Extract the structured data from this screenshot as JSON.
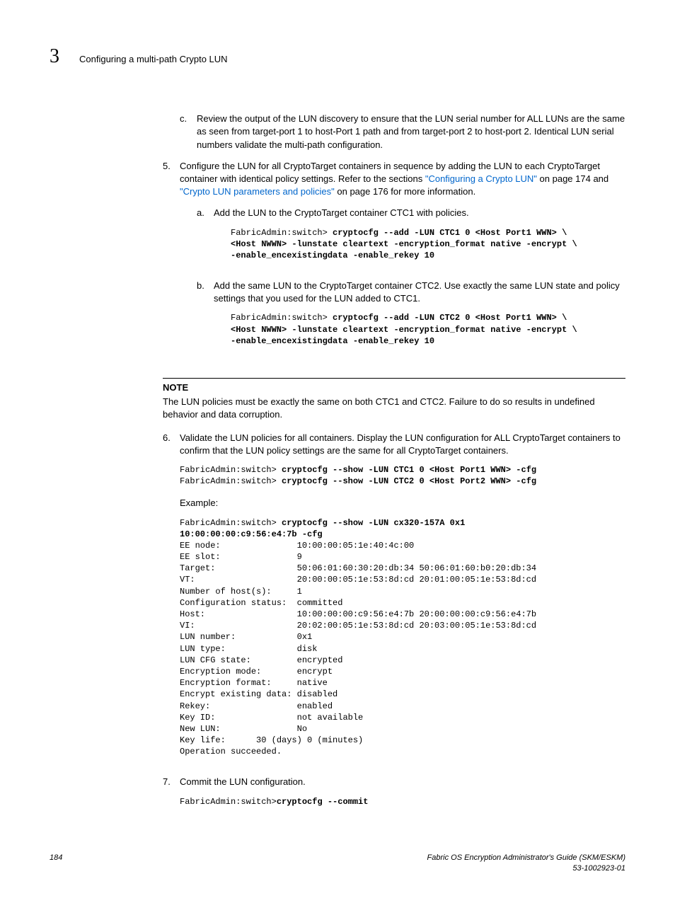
{
  "header": {
    "chapter": "3",
    "title": "Configuring a multi-path Crypto LUN"
  },
  "step_c": {
    "marker": "c.",
    "text": "Review the output of the LUN discovery to ensure that the LUN serial number for ALL LUNs are the same as seen from target-port 1 to host-Port 1 path and from target-port 2 to host-port 2. Identical LUN serial numbers validate the multi-path configuration."
  },
  "step5": {
    "marker": "5.",
    "text_before": "Configure the LUN for all CryptoTarget containers in sequence by adding the LUN to each CryptoTarget container with identical policy settings. Refer to the sections ",
    "link1": "\"Configuring a Crypto LUN\"",
    "text_mid": " on page 174 and ",
    "link2": "\"Crypto LUN parameters and policies\"",
    "text_after": " on page 176 for more information.",
    "sub_a": {
      "marker": "a.",
      "text": "Add the LUN to the CryptoTarget container CTC1 with policies.",
      "prompt": "FabricAdmin:switch> ",
      "cmd": "cryptocfg --add -LUN CTC1 0 <Host Port1 WWN> \\\n<Host NWWN> -lunstate cleartext -encryption_format native -encrypt \\\n-enable_encexistingdata -enable_rekey 10"
    },
    "sub_b": {
      "marker": "b.",
      "text": "Add the same LUN to the CryptoTarget container CTC2. Use exactly the same LUN state and policy settings that you used for the LUN added to CTC1.",
      "prompt": "FabricAdmin:switch> ",
      "cmd": "cryptocfg --add -LUN CTC2 0 <Host Port1 WWN> \\\n<Host NWWN> -lunstate cleartext -encryption_format native -encrypt \\\n-enable_encexistingdata -enable_rekey 10"
    }
  },
  "note": {
    "title": "NOTE",
    "text": "The LUN policies must be exactly the same on both CTC1 and CTC2. Failure to do so results in undefined behavior and data corruption."
  },
  "step6": {
    "marker": "6.",
    "text": "Validate the LUN policies for all containers. Display the LUN configuration for ALL CryptoTarget containers to confirm that the LUN policy settings are the same for all CryptoTarget containers.",
    "prompt1": "FabricAdmin:switch> ",
    "cmd1": "cryptocfg --show -LUN CTC1 0 <Host Port1 WWN> -cfg",
    "prompt2": "FabricAdmin:switch> ",
    "cmd2": "cryptocfg --show -LUN CTC2 0 <Host Port2 WWN> -cfg",
    "example_label": "Example:",
    "ex_prompt": "FabricAdmin:switch> ",
    "ex_cmd": "cryptocfg --show -LUN cx320-157A 0x1 \n10:00:00:00:c9:56:e4:7b -cfg",
    "ex_output": "EE node:               10:00:00:05:1e:40:4c:00\nEE slot:               9\nTarget:                50:06:01:60:30:20:db:34 50:06:01:60:b0:20:db:34\nVT:                    20:00:00:05:1e:53:8d:cd 20:01:00:05:1e:53:8d:cd\nNumber of host(s):     1\nConfiguration status:  committed\nHost:                  10:00:00:00:c9:56:e4:7b 20:00:00:00:c9:56:e4:7b\nVI:                    20:02:00:05:1e:53:8d:cd 20:03:00:05:1e:53:8d:cd\nLUN number:            0x1\nLUN type:              disk\nLUN CFG state:         encrypted\nEncryption mode:       encrypt\nEncryption format:     native\nEncrypt existing data: disabled\nRekey:                 enabled\nKey ID:                not available\nNew LUN:               No\nKey life:      30 (days) 0 (minutes)\nOperation succeeded."
  },
  "step7": {
    "marker": "7.",
    "text": "Commit the LUN configuration.",
    "prompt": "FabricAdmin:switch>",
    "cmd": "cryptocfg --commit"
  },
  "footer": {
    "page": "184",
    "title": "Fabric OS Encryption Administrator's Guide (SKM/ESKM)",
    "docnum": "53-1002923-01"
  }
}
